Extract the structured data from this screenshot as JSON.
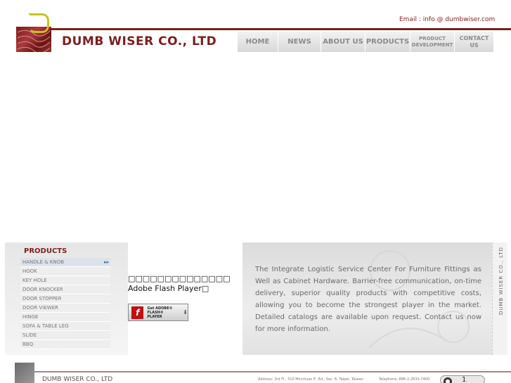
{
  "header": {
    "email": "Email : info @ dumbwiser.com",
    "company": "DUMB WISER  CO., LTD"
  },
  "nav": {
    "items": [
      {
        "label": "HOME"
      },
      {
        "label": "NEWS"
      },
      {
        "label": "ABOUT US"
      },
      {
        "label": "PRODUCTS"
      },
      {
        "label": "PRODUCT\nDEVELOPMENT"
      },
      {
        "label": "CONTACT US"
      }
    ]
  },
  "sidebar": {
    "title": "PRODUCTS",
    "items": [
      {
        "label": "HANDLE & KNOB"
      },
      {
        "label": "HOOK"
      },
      {
        "label": "KEY HOLE"
      },
      {
        "label": "DOOR KNOCKER"
      },
      {
        "label": "DOOR STOPPER"
      },
      {
        "label": "DOOR VIEWER"
      },
      {
        "label": "HINGE"
      },
      {
        "label": "SOFA & TABLE LEG"
      },
      {
        "label": "SLIDE"
      },
      {
        "label": "BBQ"
      }
    ]
  },
  "flash": {
    "message": "□□□□□□□□□□□□□□ Adobe Flash Player□",
    "badge_line1": "Get ADOBE®",
    "badge_line2": "FLASH® PLAYER"
  },
  "about": {
    "text": "The Integrate Logistic Service Center For Furniture Fittings as Well as Cabinet Hardware. Barrier-free communication, on-time delivery, superior quality products with competitive costs, allowing you to become the strongest player in the market. Detailed catalogs are available upon request. Contact us now for more information."
  },
  "vertical_label": "DUMB WISER CO., LTD",
  "footer": {
    "name": "DUMB WISER CO., LTD",
    "address": "Address: 3rd Fl., 310 Minchuan E. Rd., Sec. 6, Taipei, Taiwan",
    "phone": "Telephone: 886-2-2633-7400",
    "widget_count": "1"
  },
  "colors": {
    "brand": "#7a1f1f",
    "accent": "#c8c020",
    "nav_text": "#8a8a8a"
  }
}
